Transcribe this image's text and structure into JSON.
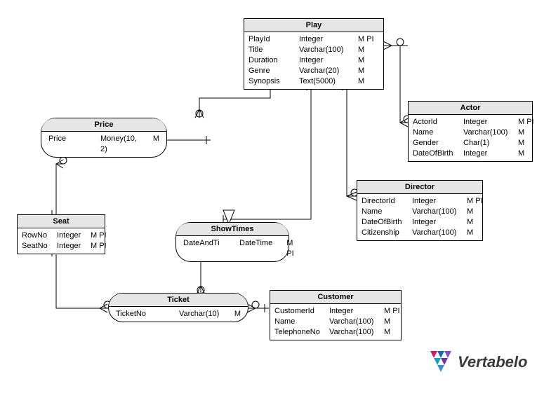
{
  "entities": {
    "play": {
      "title": "Play",
      "rows": [
        {
          "n": "PlayId",
          "t": "Integer",
          "f": "M PI"
        },
        {
          "n": "Title",
          "t": "Varchar(100)",
          "f": "M"
        },
        {
          "n": "Duration",
          "t": "Integer",
          "f": "M"
        },
        {
          "n": "Genre",
          "t": "Varchar(20)",
          "f": "M"
        },
        {
          "n": "Synopsis",
          "t": "Text(5000)",
          "f": "M"
        }
      ]
    },
    "actor": {
      "title": "Actor",
      "rows": [
        {
          "n": "ActorId",
          "t": "Integer",
          "f": "M PI"
        },
        {
          "n": "Name",
          "t": "Varchar(100)",
          "f": "M"
        },
        {
          "n": "Gender",
          "t": "Char(1)",
          "f": "M"
        },
        {
          "n": "DateOfBirth",
          "t": "Integer",
          "f": "M"
        }
      ]
    },
    "director": {
      "title": "Director",
      "rows": [
        {
          "n": "DirectorId",
          "t": "Integer",
          "f": "M PI"
        },
        {
          "n": "Name",
          "t": "Varchar(100)",
          "f": "M"
        },
        {
          "n": "DateOfBirth",
          "t": "Integer",
          "f": "M"
        },
        {
          "n": "Citizenship",
          "t": "Varchar(100)",
          "f": "M"
        }
      ]
    },
    "seat": {
      "title": "Seat",
      "rows": [
        {
          "n": "RowNo",
          "t": "Integer",
          "f": "M PI"
        },
        {
          "n": "SeatNo",
          "t": "Integer",
          "f": "M PI"
        }
      ]
    },
    "customer": {
      "title": "Customer",
      "rows": [
        {
          "n": "CustomerId",
          "t": "Integer",
          "f": "M PI"
        },
        {
          "n": "Name",
          "t": "Varchar(100)",
          "f": "M"
        },
        {
          "n": "TelephoneNo",
          "t": "Varchar(100)",
          "f": "M"
        }
      ]
    }
  },
  "assocs": {
    "price": {
      "title": "Price",
      "rows": [
        {
          "n": "Price",
          "t": "Money(10, 2)",
          "f": "M"
        }
      ]
    },
    "showtimes": {
      "title": "ShowTimes",
      "rows": [
        {
          "n": "DateAndTi",
          "t": "DateTime",
          "f": "M PI"
        }
      ]
    },
    "ticket": {
      "title": "Ticket",
      "rows": [
        {
          "n": "TicketNo",
          "t": "Varchar(10)",
          "f": "M"
        }
      ]
    }
  },
  "logo_text": "Vertabelo",
  "chart_data": {
    "type": "table",
    "title": "Entity-Relationship Diagram (Theater domain)",
    "nodes": [
      {
        "id": "Play",
        "kind": "entity",
        "attrs": [
          [
            "PlayId",
            "Integer",
            "M PI"
          ],
          [
            "Title",
            "Varchar(100)",
            "M"
          ],
          [
            "Duration",
            "Integer",
            "M"
          ],
          [
            "Genre",
            "Varchar(20)",
            "M"
          ],
          [
            "Synopsis",
            "Text(5000)",
            "M"
          ]
        ]
      },
      {
        "id": "Actor",
        "kind": "entity",
        "attrs": [
          [
            "ActorId",
            "Integer",
            "M PI"
          ],
          [
            "Name",
            "Varchar(100)",
            "M"
          ],
          [
            "Gender",
            "Char(1)",
            "M"
          ],
          [
            "DateOfBirth",
            "Integer",
            "M"
          ]
        ]
      },
      {
        "id": "Director",
        "kind": "entity",
        "attrs": [
          [
            "DirectorId",
            "Integer",
            "M PI"
          ],
          [
            "Name",
            "Varchar(100)",
            "M"
          ],
          [
            "DateOfBirth",
            "Integer",
            "M"
          ],
          [
            "Citizenship",
            "Varchar(100)",
            "M"
          ]
        ]
      },
      {
        "id": "Seat",
        "kind": "entity",
        "attrs": [
          [
            "RowNo",
            "Integer",
            "M PI"
          ],
          [
            "SeatNo",
            "Integer",
            "M PI"
          ]
        ]
      },
      {
        "id": "Customer",
        "kind": "entity",
        "attrs": [
          [
            "CustomerId",
            "Integer",
            "M PI"
          ],
          [
            "Name",
            "Varchar(100)",
            "M"
          ],
          [
            "TelephoneNo",
            "Varchar(100)",
            "M"
          ]
        ]
      },
      {
        "id": "Price",
        "kind": "association",
        "attrs": [
          [
            "Price",
            "Money(10, 2)",
            "M"
          ]
        ]
      },
      {
        "id": "ShowTimes",
        "kind": "association",
        "attrs": [
          [
            "DateAndTi",
            "DateTime",
            "M PI"
          ]
        ]
      },
      {
        "id": "Ticket",
        "kind": "association",
        "attrs": [
          [
            "TicketNo",
            "Varchar(10)",
            "M"
          ]
        ]
      }
    ],
    "edges": [
      {
        "from": "Play",
        "to": "Actor",
        "fromCard": "many",
        "toCard": "many"
      },
      {
        "from": "Play",
        "to": "Director",
        "fromCard": "one",
        "toCard": "many"
      },
      {
        "from": "Play",
        "to": "ShowTimes",
        "fromCard": "one",
        "toCard": "many",
        "inherits": true
      },
      {
        "from": "Play",
        "to": "Price",
        "fromCard": "one",
        "toCard": "many"
      },
      {
        "from": "Seat",
        "to": "Price",
        "fromCard": "one",
        "toCard": "many"
      },
      {
        "from": "Seat",
        "to": "Ticket",
        "fromCard": "one",
        "toCard": "many"
      },
      {
        "from": "ShowTimes",
        "to": "Ticket",
        "fromCard": "one",
        "toCard": "many"
      },
      {
        "from": "Customer",
        "to": "Ticket",
        "fromCard": "one",
        "toCard": "many"
      }
    ]
  }
}
